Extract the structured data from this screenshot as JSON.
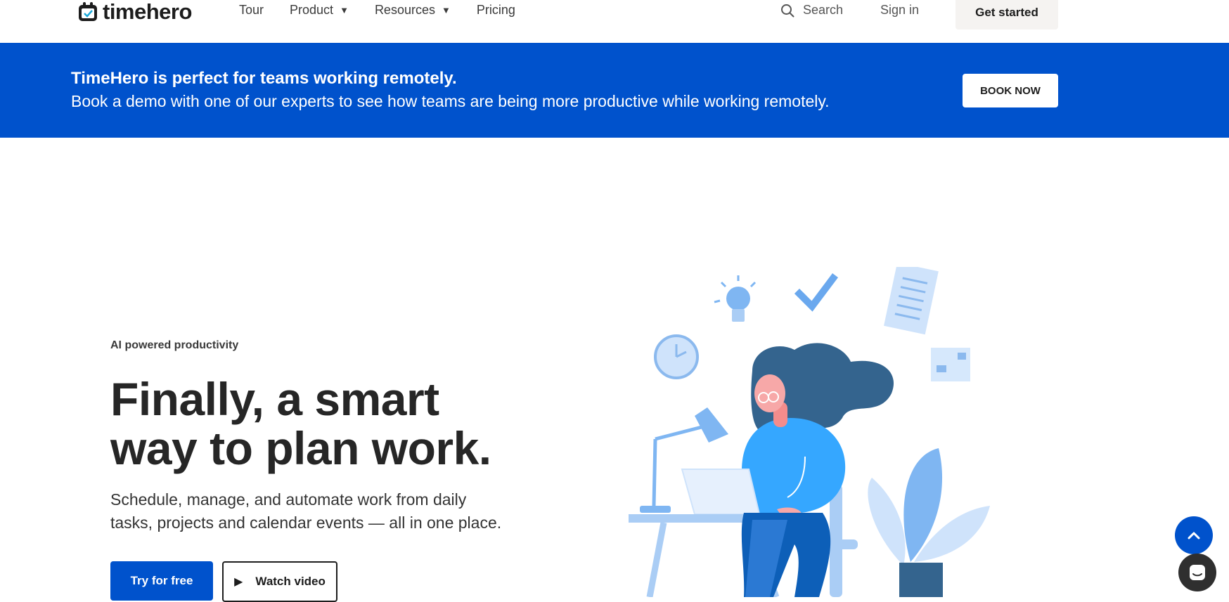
{
  "header": {
    "logo_text": "timehero",
    "nav": [
      {
        "label": "Tour"
      },
      {
        "label": "Product"
      },
      {
        "label": "Resources"
      },
      {
        "label": "Pricing"
      }
    ],
    "search_label": "Search",
    "signin_label": "Sign in",
    "cta_label": "Get started"
  },
  "banner": {
    "title": "TimeHero is perfect for teams working remotely.",
    "text": "Book a demo with one of our experts to see how teams are being more productive while working remotely.",
    "button_label": "BOOK NOW"
  },
  "hero": {
    "eyebrow": "AI powered productivity",
    "headline_line1": "Finally, a smart",
    "headline_line2": "way to plan work.",
    "subtext_line1": "Schedule, manage, and automate work from daily",
    "subtext_line2": "tasks, projects and calendar events — all in one place.",
    "primary_button": "Try for free",
    "secondary_button": "Watch video"
  },
  "colors": {
    "brand_blue": "#0052cc",
    "chat_bg": "#2f2f2f"
  },
  "icons": [
    "logo-icon",
    "search-icon",
    "caret-down-icon",
    "play-icon",
    "chevron-up-icon",
    "chat-icon"
  ]
}
